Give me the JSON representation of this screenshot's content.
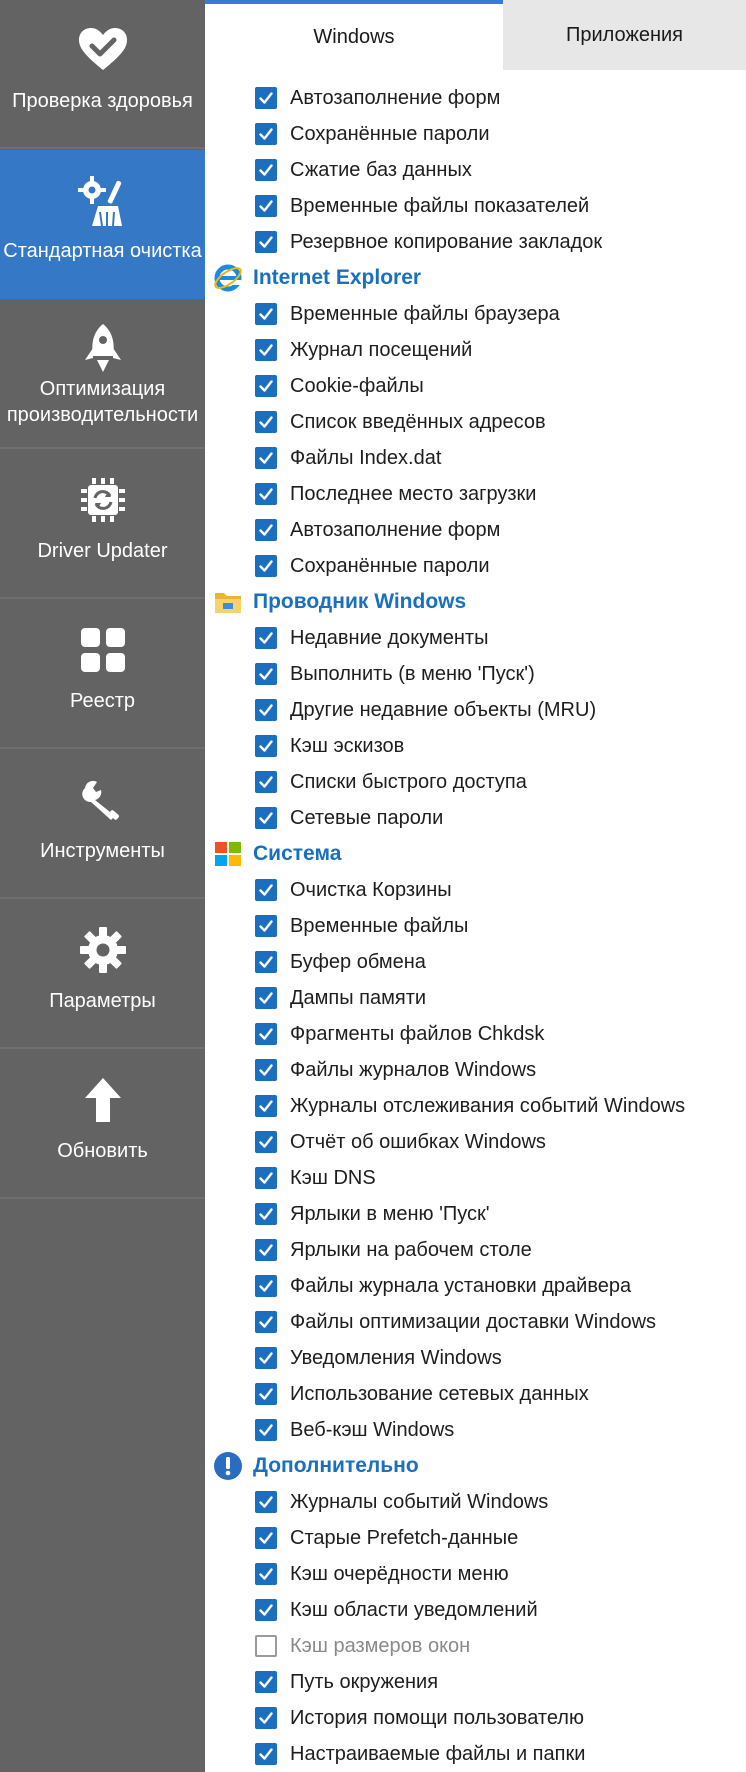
{
  "sidebar": {
    "items": [
      {
        "label": "Проверка здоровья",
        "icon": "heart-check-icon",
        "active": false
      },
      {
        "label": "Стандартная очистка",
        "icon": "broom-gear-icon",
        "active": true
      },
      {
        "label": "Оптимизация производительности",
        "icon": "rocket-icon",
        "active": false
      },
      {
        "label": "Driver Updater",
        "icon": "chip-icon",
        "active": false
      },
      {
        "label": "Реестр",
        "icon": "grid-icon",
        "active": false
      },
      {
        "label": "Инструменты",
        "icon": "wrench-icon",
        "active": false
      },
      {
        "label": "Параметры",
        "icon": "gear-icon",
        "active": false
      },
      {
        "label": "Обновить",
        "icon": "arrow-up-icon",
        "active": false
      }
    ]
  },
  "tabs": {
    "windows": "Windows",
    "apps": "Приложения"
  },
  "colors": {
    "sidebar_bg": "#636363",
    "active_bg": "#3478c6",
    "accent": "#1a6fbf"
  },
  "groups": [
    {
      "title": null,
      "icon": null,
      "items": [
        {
          "label": "Автозаполнение форм",
          "checked": true
        },
        {
          "label": "Сохранённые пароли",
          "checked": true
        },
        {
          "label": "Сжатие баз данных",
          "checked": true
        },
        {
          "label": "Временные файлы показателей",
          "checked": true
        },
        {
          "label": "Резервное копирование закладок",
          "checked": true
        }
      ]
    },
    {
      "title": "Internet Explorer",
      "icon": "internet-explorer-icon",
      "items": [
        {
          "label": "Временные файлы браузера",
          "checked": true
        },
        {
          "label": "Журнал посещений",
          "checked": true
        },
        {
          "label": "Cookie-файлы",
          "checked": true
        },
        {
          "label": "Список введённых адресов",
          "checked": true
        },
        {
          "label": "Файлы Index.dat",
          "checked": true
        },
        {
          "label": "Последнее место загрузки",
          "checked": true
        },
        {
          "label": "Автозаполнение форм",
          "checked": true
        },
        {
          "label": "Сохранённые пароли",
          "checked": true
        }
      ]
    },
    {
      "title": "Проводник Windows",
      "icon": "folder-icon",
      "items": [
        {
          "label": "Недавние документы",
          "checked": true
        },
        {
          "label": "Выполнить (в меню 'Пуск')",
          "checked": true
        },
        {
          "label": "Другие недавние объекты (MRU)",
          "checked": true
        },
        {
          "label": "Кэш эскизов",
          "checked": true
        },
        {
          "label": "Списки быстрого доступа",
          "checked": true
        },
        {
          "label": "Сетевые пароли",
          "checked": true
        }
      ]
    },
    {
      "title": "Система",
      "icon": "windows-logo-icon",
      "items": [
        {
          "label": "Очистка Корзины",
          "checked": true
        },
        {
          "label": "Временные файлы",
          "checked": true
        },
        {
          "label": "Буфер обмена",
          "checked": true
        },
        {
          "label": "Дампы памяти",
          "checked": true
        },
        {
          "label": "Фрагменты файлов Chkdsk",
          "checked": true
        },
        {
          "label": "Файлы журналов Windows",
          "checked": true
        },
        {
          "label": "Журналы отслеживания событий Windows",
          "checked": true
        },
        {
          "label": "Отчёт об ошибках Windows",
          "checked": true
        },
        {
          "label": "Кэш DNS",
          "checked": true
        },
        {
          "label": "Ярлыки в меню 'Пуск'",
          "checked": true
        },
        {
          "label": "Ярлыки на рабочем столе",
          "checked": true
        },
        {
          "label": "Файлы журнала установки драйвера",
          "checked": true
        },
        {
          "label": "Файлы оптимизации доставки Windows",
          "checked": true
        },
        {
          "label": "Уведомления Windows",
          "checked": true
        },
        {
          "label": "Использование сетевых данных",
          "checked": true
        },
        {
          "label": "Веб-кэш Windows",
          "checked": true
        }
      ]
    },
    {
      "title": "Дополнительно",
      "icon": "exclamation-circle-icon",
      "items": [
        {
          "label": "Журналы событий Windows",
          "checked": true
        },
        {
          "label": "Старые Prefetch-данные",
          "checked": true
        },
        {
          "label": "Кэш очерёдности меню",
          "checked": true
        },
        {
          "label": "Кэш области уведомлений",
          "checked": true
        },
        {
          "label": "Кэш размеров окон",
          "checked": false
        },
        {
          "label": "Путь окружения",
          "checked": true
        },
        {
          "label": "История помощи пользователю",
          "checked": true
        },
        {
          "label": "Настраиваемые файлы и папки",
          "checked": true
        }
      ]
    }
  ]
}
